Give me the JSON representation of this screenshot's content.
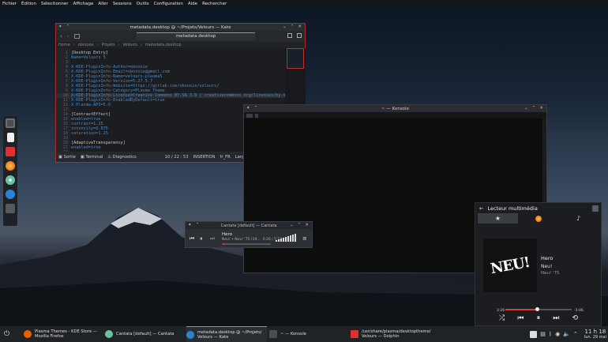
{
  "menu": [
    "Fichier",
    "Édition",
    "Sélectionner",
    "Affichage",
    "Aller",
    "Sessions",
    "Outils",
    "Configuration",
    "Aide",
    "Rechercher"
  ],
  "kate": {
    "title": "metadata.desktop @ ~/Projets/Velours — Kate",
    "tab": "metadata.desktop",
    "breadcrumbs": [
      "Home",
      "obnoxie",
      "Projets",
      "Velours",
      "metadata.desktop"
    ],
    "lines": [
      {
        "n": "1",
        "t": "[Desktop Entry]",
        "c": "k-grey"
      },
      {
        "n": "2",
        "t": "Name=Velours 5",
        "c": "k-blue"
      },
      {
        "n": "3",
        "t": "",
        "c": "k-grey"
      },
      {
        "n": "4",
        "t": "X-KDE-PluginInfo-Author=obnoxie",
        "c": "k-blue"
      },
      {
        "n": "5",
        "t": "X-KDE-PluginInfo-Email=obnoxie@gmail.com",
        "c": "k-blue"
      },
      {
        "n": "6",
        "t": "X-KDE-PluginInfo-Name=velours-plasma5",
        "c": "k-blue"
      },
      {
        "n": "7",
        "t": "X-KDE-PluginInfo-Version=5.27.5.7",
        "c": "k-blue"
      },
      {
        "n": "8",
        "t": "X-KDE-PluginInfo-Website=https://gitlab.com/obnoxie/velours/",
        "c": "k-blue"
      },
      {
        "n": "9",
        "t": "X-KDE-PluginInfo-Category=Plasma Theme",
        "c": "k-blue"
      },
      {
        "n": "10",
        "t": "X-KDE-PluginInfo-License=Creative Commons BY-SA 3.0 | creativecommons.org/licenses/by-sa/3.0/",
        "c": "k-blue"
      },
      {
        "n": "11",
        "t": "X-KDE-PluginInfo-EnabledByDefault=true",
        "c": "k-blue"
      },
      {
        "n": "12",
        "t": "X-Plasma-API=5.0",
        "c": "k-blue"
      },
      {
        "n": "13",
        "t": "",
        "c": "k-grey"
      },
      {
        "n": "14",
        "t": "[ContrastEffect]",
        "c": "k-grey"
      },
      {
        "n": "15",
        "t": "enabled=true",
        "c": "k-blue"
      },
      {
        "n": "16",
        "t": "contrast=1.25",
        "c": "k-blue"
      },
      {
        "n": "17",
        "t": "intensity=0.875",
        "c": "k-blue"
      },
      {
        "n": "18",
        "t": "saturation=1.25",
        "c": "k-blue"
      },
      {
        "n": "19",
        "t": "",
        "c": "k-grey"
      },
      {
        "n": "20",
        "t": "[AdaptiveTransparency]",
        "c": "k-grey"
      },
      {
        "n": "21",
        "t": "enabled=true",
        "c": "k-blue"
      },
      {
        "n": "22",
        "t": "",
        "c": "k-grey"
      }
    ],
    "status": {
      "sidebar": "Sortie",
      "terminal": "Terminal",
      "diagnostics": "Diagnostics",
      "position": "10 / 22 : 53",
      "mode": "INSERTION",
      "lang": "fr_FR",
      "indent": "Largeur de t"
    }
  },
  "konsole": {
    "title": "~ — Konsole"
  },
  "cantata": {
    "title": "Cantata [default] — Cantata",
    "song": "Hero",
    "sub": "Neu! • Neu! '75 (19...",
    "time": "0:26 / 7:12",
    "progress": 0.06
  },
  "media": {
    "header": "Lecteur multimédia",
    "cover_text": "NEU!",
    "title": "Hero",
    "artist": "Neu!",
    "album": "Neu! '75",
    "position": "3:26",
    "remaining": "-3:46",
    "progress": 0.48
  },
  "taskbar": {
    "tasks": [
      {
        "line1": "Plasma Themes - KDE Store —",
        "line2": "Mozilla Firefox",
        "color": "#e66000"
      },
      {
        "line1": "Cantata [default] — Cantata",
        "line2": "",
        "color": "#6bc2a0"
      },
      {
        "line1": "metadata.desktop @ ~/Projets/",
        "line2": "Velours — Kate",
        "color": "#2c83d6"
      },
      {
        "line1": "~ — Konsole",
        "line2": "",
        "color": "#4a4d52"
      },
      {
        "line1": "/usr/share/plasma/desktoptheme/",
        "line2": "Velours — Dolphin",
        "color": "#e03030"
      }
    ],
    "time": "11 h 18",
    "date": "lun. 29 mai"
  }
}
